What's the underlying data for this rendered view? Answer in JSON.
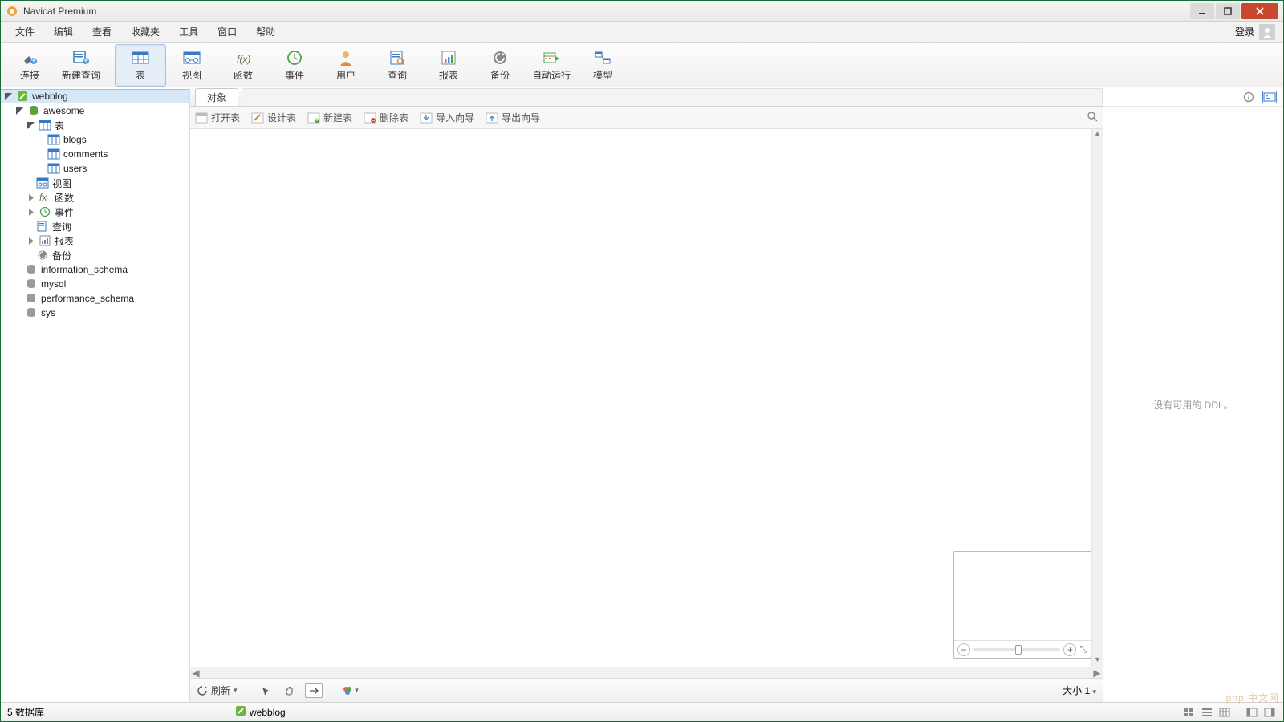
{
  "app": {
    "title": "Navicat Premium"
  },
  "menu": {
    "items": [
      "文件",
      "编辑",
      "查看",
      "收藏夹",
      "工具",
      "窗口",
      "帮助"
    ],
    "login": "登录"
  },
  "toolbar": {
    "items": [
      {
        "label": "连接",
        "icon": "plug"
      },
      {
        "label": "新建查询",
        "icon": "newquery"
      },
      {
        "label": "表",
        "icon": "table",
        "active": true
      },
      {
        "label": "视图",
        "icon": "view"
      },
      {
        "label": "函数",
        "icon": "fx"
      },
      {
        "label": "事件",
        "icon": "event"
      },
      {
        "label": "用户",
        "icon": "user"
      },
      {
        "label": "查询",
        "icon": "query"
      },
      {
        "label": "报表",
        "icon": "report"
      },
      {
        "label": "备份",
        "icon": "backup"
      },
      {
        "label": "自动运行",
        "icon": "autorun"
      },
      {
        "label": "模型",
        "icon": "model"
      }
    ]
  },
  "tree": {
    "connection": "webblog",
    "database": "awesome",
    "tablesLabel": "表",
    "tables": [
      "blogs",
      "comments",
      "users"
    ],
    "viewsLabel": "视图",
    "functionsLabel": "函数",
    "eventsLabel": "事件",
    "queriesLabel": "查询",
    "reportsLabel": "报表",
    "backupsLabel": "备份",
    "otherDbs": [
      "information_schema",
      "mysql",
      "performance_schema",
      "sys"
    ]
  },
  "centerTabs": {
    "active": "对象"
  },
  "subtoolbar": {
    "items": [
      "打开表",
      "设计表",
      "新建表",
      "删除表",
      "导入向导",
      "导出向导"
    ]
  },
  "rightPanel": {
    "empty": "没有可用的 DDL。"
  },
  "bottomBar": {
    "refresh": "刷新",
    "size": "大小 1"
  },
  "statusBar": {
    "left": "5 数据库",
    "conn": "webblog"
  },
  "watermark": "php 中文网"
}
